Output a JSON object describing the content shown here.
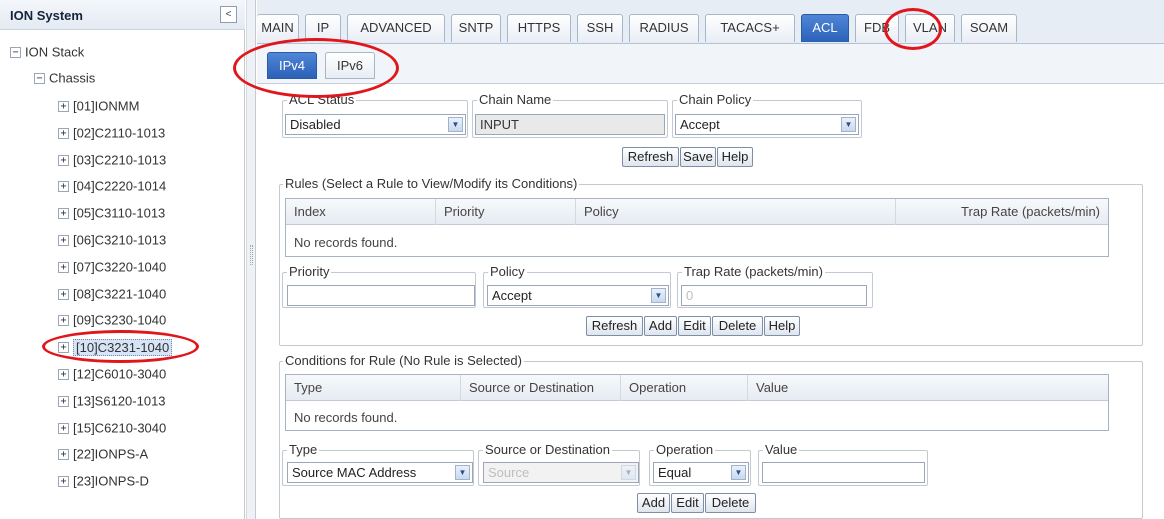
{
  "tree": {
    "title": "ION System",
    "collapse_glyph": "<",
    "root_label": "ION Stack",
    "chassis_label": "Chassis",
    "expand_glyph": "+",
    "collapse_node_glyph": "−",
    "items": [
      {
        "label": "[01]IONMM"
      },
      {
        "label": "[02]C2110-1013"
      },
      {
        "label": "[03]C2210-1013"
      },
      {
        "label": "[04]C2220-1014"
      },
      {
        "label": "[05]C3110-1013"
      },
      {
        "label": "[06]C3210-1013"
      },
      {
        "label": "[07]C3220-1040"
      },
      {
        "label": "[08]C3221-1040"
      },
      {
        "label": "[09]C3230-1040"
      },
      {
        "label": "[10]C3231-1040",
        "selected": true
      },
      {
        "label": "[12]C6010-3040"
      },
      {
        "label": "[13]S6120-1013"
      },
      {
        "label": "[15]C6210-3040"
      },
      {
        "label": "[22]IONPS-A"
      },
      {
        "label": "[23]IONPS-D"
      }
    ]
  },
  "tabs": [
    "MAIN",
    "IP",
    "ADVANCED",
    "SNTP",
    "HTTPS",
    "SSH",
    "RADIUS",
    "TACACS+",
    "ACL",
    "FDB",
    "VLAN",
    "SOAM"
  ],
  "active_tab": "ACL",
  "subtabs": [
    "IPv4",
    "IPv6"
  ],
  "active_subtab": "IPv4",
  "chain": {
    "acl_status_label": "ACL Status",
    "acl_status_value": "Disabled",
    "chain_name_label": "Chain Name",
    "chain_name_value": "INPUT",
    "chain_policy_label": "Chain Policy",
    "chain_policy_value": "Accept",
    "buttons": [
      "Refresh",
      "Save",
      "Help"
    ]
  },
  "rules": {
    "title": "Rules (Select a Rule to View/Modify its Conditions)",
    "columns": [
      "Index",
      "Priority",
      "Policy",
      "Trap Rate (packets/min)"
    ],
    "empty_text": "No records found.",
    "priority_label": "Priority",
    "priority_value": "",
    "policy_label": "Policy",
    "policy_value": "Accept",
    "trap_rate_label": "Trap Rate (packets/min)",
    "trap_rate_value": "0",
    "buttons": [
      "Refresh",
      "Add",
      "Edit",
      "Delete",
      "Help"
    ]
  },
  "conditions": {
    "title": "Conditions for Rule (No Rule is Selected)",
    "columns": [
      "Type",
      "Source or Destination",
      "Operation",
      "Value"
    ],
    "empty_text": "No records found.",
    "type_label": "Type",
    "type_value": "Source MAC Address",
    "srcdst_label": "Source or Destination",
    "srcdst_value": "Source",
    "operation_label": "Operation",
    "operation_value": "Equal",
    "value_label": "Value",
    "value_value": "",
    "buttons": [
      "Add",
      "Edit",
      "Delete"
    ]
  },
  "colors": {
    "active_tab": "#2b61b8",
    "annotation": "#e0161b"
  },
  "icons": {
    "dropdown": "chevron-down-icon",
    "expand": "plus-box-icon",
    "collapse": "minus-box-icon"
  }
}
